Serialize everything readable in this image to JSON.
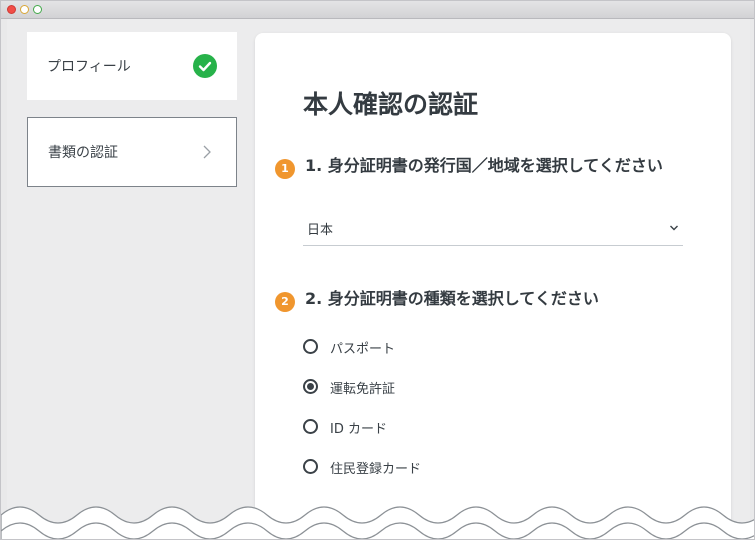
{
  "window": {
    "traffic_lights": {
      "close": "#f14d47",
      "minimize": "#d9a737",
      "zoom": "#43a94a"
    }
  },
  "sidebar": {
    "items": [
      {
        "label": "プロフィール",
        "status": "completed",
        "icon": "check-circle-icon"
      },
      {
        "label": "書類の認証",
        "status": "current",
        "icon": "chevron-right-icon"
      }
    ]
  },
  "main": {
    "title": "本人確認の認証",
    "accent_color": "#f0962e",
    "success_color": "#27b24a",
    "step1": {
      "number": "1",
      "title": "1. 身分証明書の発行国／地域を選択してください",
      "select_value": "日本"
    },
    "step2": {
      "number": "2",
      "title": "2. 身分証明書の種類を選択してください",
      "options": [
        {
          "label": "パスポート",
          "selected": false
        },
        {
          "label": "運転免許証",
          "selected": true
        },
        {
          "label": "ID カード",
          "selected": false
        },
        {
          "label": "住民登録カード",
          "selected": false
        }
      ]
    }
  }
}
